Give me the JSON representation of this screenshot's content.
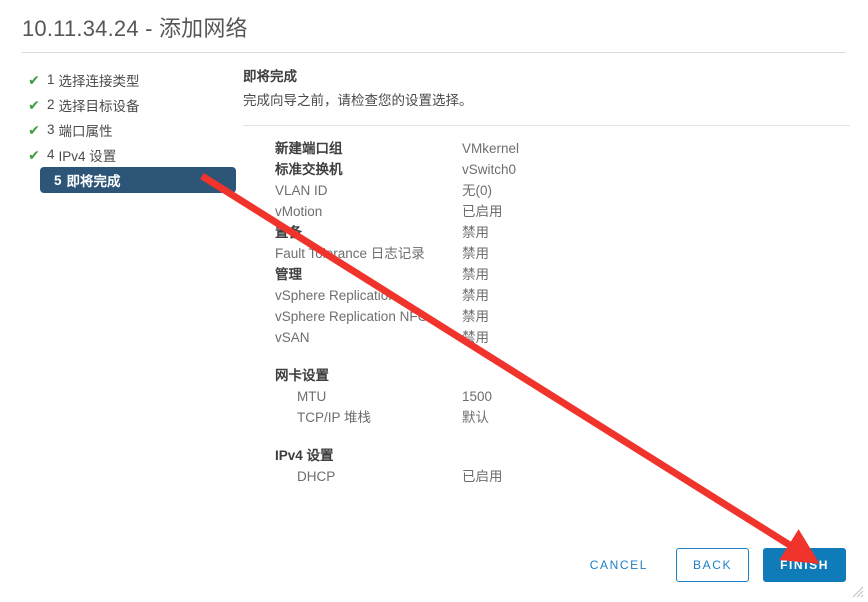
{
  "dialog": {
    "title": "10.11.34.24 - 添加网络"
  },
  "steps": [
    {
      "num": "1",
      "label": "选择连接类型",
      "state": "done",
      "check": "✔"
    },
    {
      "num": "2",
      "label": "选择目标设备",
      "state": "done",
      "check": "✔"
    },
    {
      "num": "3",
      "label": "端口属性",
      "state": "done",
      "check": "✔"
    },
    {
      "num": "4",
      "label": "IPv4 设置",
      "state": "done",
      "check": "✔"
    },
    {
      "num": "5",
      "label": "即将完成",
      "state": "current",
      "check": ""
    }
  ],
  "content": {
    "heading": "即将完成",
    "subtitle": "完成向导之前，请检查您的设置选择。",
    "main_rows": [
      {
        "label": "新建端口组",
        "value": "VMkernel",
        "strong": true
      },
      {
        "label": "标准交换机",
        "value": "vSwitch0",
        "strong": true
      },
      {
        "label": "VLAN ID",
        "value": "无(0)",
        "strong": false
      },
      {
        "label": "vMotion",
        "value": "已启用",
        "strong": false
      },
      {
        "label": "置备",
        "value": "禁用",
        "strong": true
      },
      {
        "label": "Fault Tolerance 日志记录",
        "value": "禁用",
        "strong": false
      },
      {
        "label": "管理",
        "value": "禁用",
        "strong": true
      },
      {
        "label": "vSphere Replication",
        "value": "禁用",
        "strong": false
      },
      {
        "label": "vSphere Replication NFC",
        "value": "禁用",
        "strong": false
      },
      {
        "label": "vSAN",
        "value": "禁用",
        "strong": false
      }
    ],
    "sections": [
      {
        "title": "网卡设置",
        "rows": [
          {
            "label": "MTU",
            "value": "1500"
          },
          {
            "label": "TCP/IP 堆栈",
            "value": "默认"
          }
        ]
      },
      {
        "title": "IPv4 设置",
        "rows": [
          {
            "label": "DHCP",
            "value": "已启用"
          }
        ]
      }
    ]
  },
  "footer": {
    "cancel_label": "CANCEL",
    "back_label": "BACK",
    "finish_label": "FINISH"
  },
  "annotation": {
    "arrow_color": "#f0342c"
  },
  "colors": {
    "accent_blue": "#0f7bb8",
    "link_blue": "#1c7fc4",
    "current_step_bg": "#2c5578",
    "check_green": "#3c9b3c",
    "arrow_red": "#f0342c"
  }
}
